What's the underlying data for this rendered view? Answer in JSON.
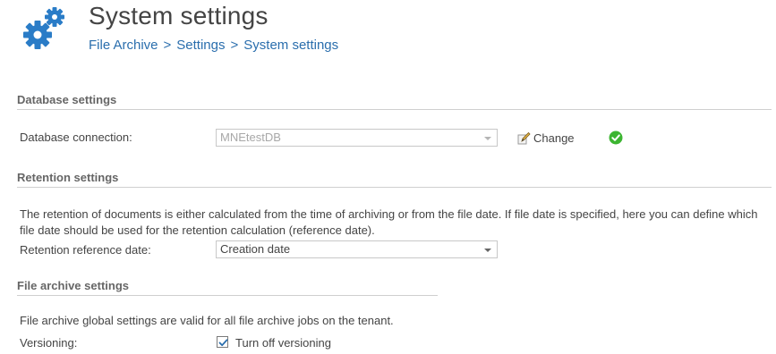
{
  "header": {
    "title": "System settings",
    "breadcrumb": [
      "File Archive",
      "Settings",
      "System settings"
    ],
    "breadcrumb_separator": ">",
    "icon": "gears-icon"
  },
  "database_settings": {
    "heading": "Database settings",
    "connection_label": "Database connection:",
    "connection_value": "MNEtestDB",
    "change_label": "Change",
    "change_icon": "edit-pencil-icon",
    "status_icon": "check-circle-icon"
  },
  "retention_settings": {
    "heading": "Retention settings",
    "description": "The retention of documents is either calculated from the time of archiving or from the file date. If file date is specified, here you can define which file date should be used for the retention calculation (reference date).",
    "reference_label": "Retention reference date:",
    "reference_value": "Creation date"
  },
  "file_archive_settings": {
    "heading": "File archive settings",
    "description": "File archive global settings are valid for all file archive jobs on the tenant.",
    "versioning_label": "Versioning:",
    "versioning_checkbox_label": "Turn off versioning",
    "versioning_checked": true
  },
  "colors": {
    "breadcrumb": "#2a6ead",
    "gear": "#2a7cc7",
    "ok": "#3cb531"
  }
}
